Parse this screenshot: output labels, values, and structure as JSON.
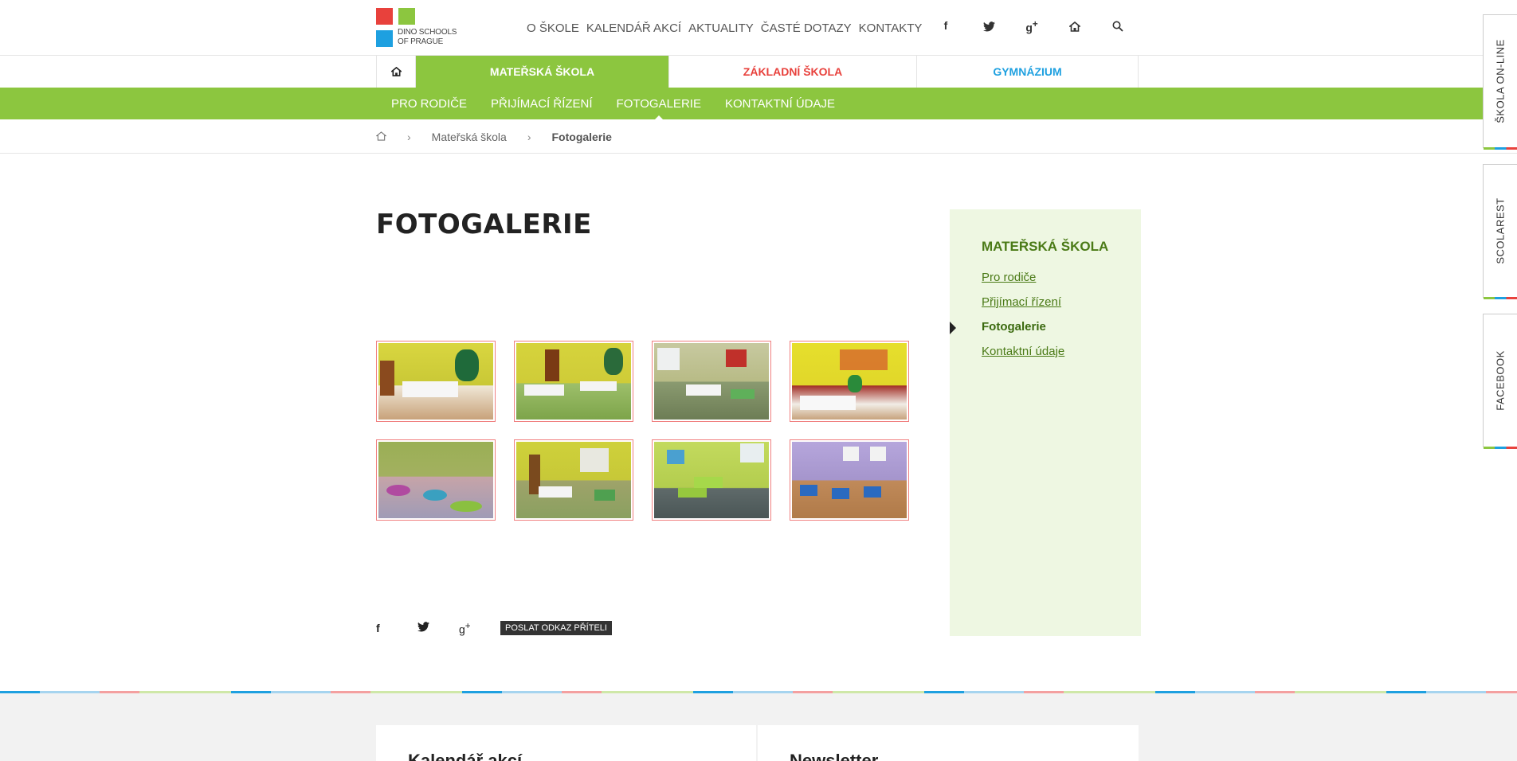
{
  "logo": {
    "line1": "DINO SCHOOLS",
    "line2": "OF PRAGUE",
    "colors": [
      "#e8413c",
      "#8cc63f",
      "#1ea0e0"
    ]
  },
  "topnav": [
    "O ŠKOLE",
    "KALENDÁŘ AKCÍ",
    "AKTUALITY",
    "ČASTÉ DOTAZY",
    "KONTAKTY"
  ],
  "top_icons": [
    "facebook-icon",
    "twitter-icon",
    "google-plus-icon",
    "home-icon",
    "search-icon"
  ],
  "tabs": {
    "ms": "MATEŘSKÁ ŠKOLA",
    "zs": "ZÁKLADNÍ ŠKOLA",
    "gym": "GYMNÁZIUM"
  },
  "subnav": [
    "PRO RODIČE",
    "PŘIJÍMACÍ ŘÍZENÍ",
    "FOTOGALERIE",
    "KONTAKTNÍ ÚDAJE"
  ],
  "breadcrumb": {
    "level1": "Mateřská škola",
    "current": "Fotogalerie"
  },
  "page_title": "FOTOGALERIE",
  "gallery": [
    {
      "name": "classroom-photo-1"
    },
    {
      "name": "classroom-photo-2"
    },
    {
      "name": "classroom-photo-3"
    },
    {
      "name": "classroom-photo-4"
    },
    {
      "name": "classroom-photo-5"
    },
    {
      "name": "classroom-photo-6"
    },
    {
      "name": "classroom-photo-7"
    },
    {
      "name": "classroom-photo-8"
    }
  ],
  "share": {
    "send_link": "POSLAT ODKAZ PŘÍTELI"
  },
  "sidebar": {
    "title": "MATEŘSKÁ ŠKOLA",
    "items": [
      "Pro rodiče",
      "Přijímací řízení",
      "Fotogalerie",
      "Kontaktní údaje"
    ]
  },
  "side_tabs": [
    "ŠKOLA ON-LINE",
    "SCOLAREST",
    "FACEBOOK"
  ],
  "footer": {
    "card1": "Kalendář akcí",
    "card2": "Newsletter"
  },
  "colors": {
    "green": "#8cc63f",
    "red": "#e8413c",
    "blue": "#1ea0e0",
    "sidebar_bg": "#eef7e2"
  }
}
